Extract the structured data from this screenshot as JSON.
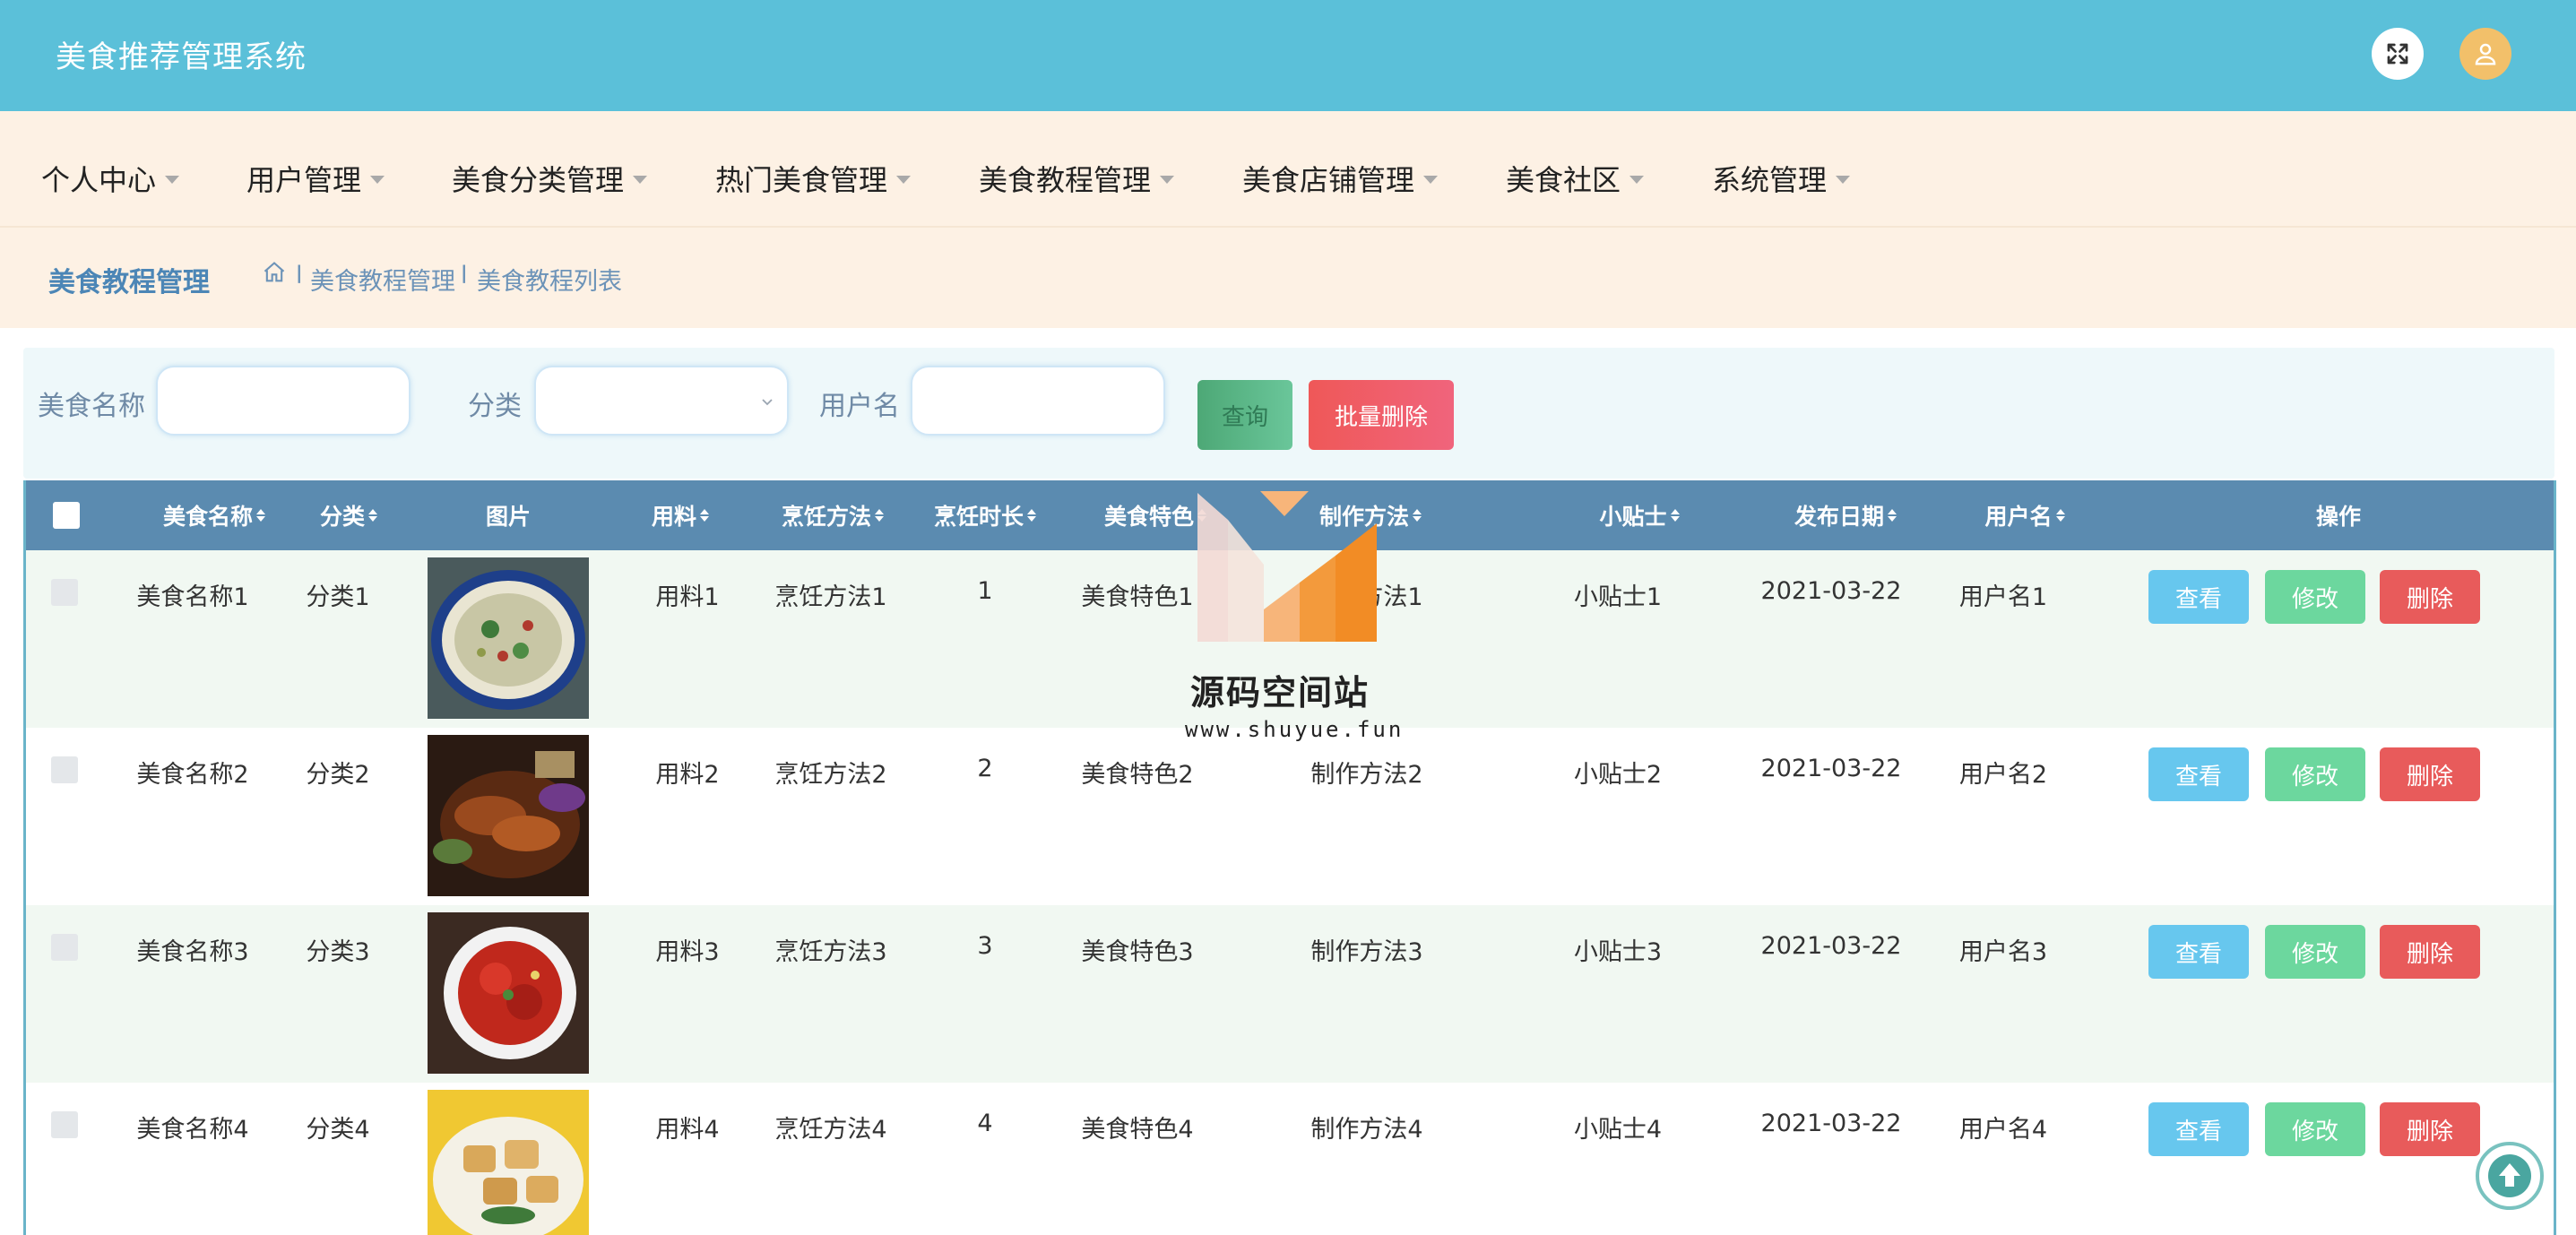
{
  "app": {
    "title": "美食推荐管理系统"
  },
  "header": {
    "fullscreen_icon": "expand-icon",
    "user_icon": "user-icon"
  },
  "nav": {
    "items": [
      {
        "label": "个人中心"
      },
      {
        "label": "用户管理"
      },
      {
        "label": "美食分类管理"
      },
      {
        "label": "热门美食管理"
      },
      {
        "label": "美食教程管理"
      },
      {
        "label": "美食店铺管理"
      },
      {
        "label": "美食社区"
      },
      {
        "label": "系统管理"
      }
    ]
  },
  "breadcrumb": {
    "title": "美食教程管理",
    "separator": "l",
    "path": [
      "美食教程管理",
      "美食教程列表"
    ]
  },
  "search": {
    "name_label": "美食名称",
    "name_value": "",
    "category_label": "分类",
    "category_value": "",
    "username_label": "用户名",
    "username_value": "",
    "query_button": "查询",
    "batch_delete_button": "批量删除"
  },
  "table": {
    "columns": [
      "美食名称",
      "分类",
      "图片",
      "用料",
      "烹饪方法",
      "烹饪时长",
      "美食特色",
      "制作方法",
      "小贴士",
      "发布日期",
      "用户名",
      "操作"
    ],
    "rows": [
      {
        "name": "美食名称1",
        "category": "分类1",
        "ingredients": "用料1",
        "method": "烹饪方法1",
        "duration": "1",
        "feature": "美食特色1",
        "steps": "制作方法1",
        "tips": "小贴士1",
        "date": "2021-03-22",
        "user": "用户名1"
      },
      {
        "name": "美食名称2",
        "category": "分类2",
        "ingredients": "用料2",
        "method": "烹饪方法2",
        "duration": "2",
        "feature": "美食特色2",
        "steps": "制作方法2",
        "tips": "小贴士2",
        "date": "2021-03-22",
        "user": "用户名2"
      },
      {
        "name": "美食名称3",
        "category": "分类3",
        "ingredients": "用料3",
        "method": "烹饪方法3",
        "duration": "3",
        "feature": "美食特色3",
        "steps": "制作方法3",
        "tips": "小贴士3",
        "date": "2021-03-22",
        "user": "用户名3"
      },
      {
        "name": "美食名称4",
        "category": "分类4",
        "ingredients": "用料4",
        "method": "烹饪方法4",
        "duration": "4",
        "feature": "美食特色4",
        "steps": "制作方法4",
        "tips": "小贴士4",
        "date": "2021-03-22",
        "user": "用户名4"
      }
    ],
    "actions": {
      "view": "查看",
      "edit": "修改",
      "delete": "删除"
    }
  },
  "watermark": {
    "name": "源码空间站",
    "url": "www.shuyue.fun"
  },
  "colors": {
    "topbar": "#5bc0d9",
    "nav_bg": "#fdf1e4",
    "table_header": "#5b8bb0",
    "view": "#67c7ee",
    "edit": "#6cd79e",
    "delete": "#e85b5b"
  }
}
